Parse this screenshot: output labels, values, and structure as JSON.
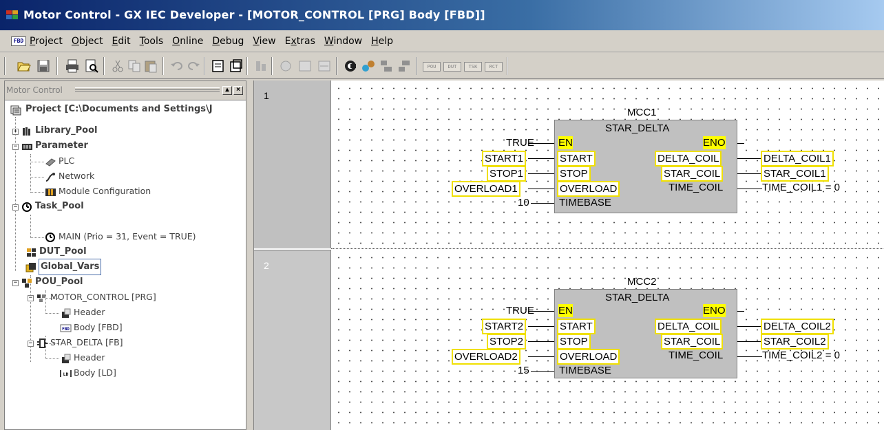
{
  "window": {
    "title": "Motor Control - GX IEC Developer - [MOTOR_CONTROL [PRG] Body [FBD]]",
    "mdi_icon_label": "FBD"
  },
  "menu": [
    "Project",
    "Object",
    "Edit",
    "Tools",
    "Online",
    "Debug",
    "View",
    "Extras",
    "Window",
    "Help"
  ],
  "toolbar": {
    "buttons": [
      "open-icon",
      "save-icon",
      "print-icon",
      "print-preview-icon",
      "cut-icon",
      "copy-icon",
      "paste-icon",
      "undo-icon",
      "redo-icon",
      "properties-icon",
      "open-object-icon",
      "check-icon",
      "build-icon",
      "rebuild-icon",
      "rebuild-all-icon",
      "monitor-icon",
      "transfer-icon",
      "download-icon",
      "upload-icon"
    ],
    "labels": [
      "POU",
      "DUT",
      "TSK",
      "RCT"
    ]
  },
  "project_panel": {
    "title": "Motor Control",
    "tree": [
      {
        "label": "Project [C:\\Documents and Settings\\J",
        "bold": true
      },
      {
        "label": "Library_Pool",
        "bold": true
      },
      {
        "label": "Parameter",
        "bold": true
      },
      {
        "label": "PLC",
        "bold": false
      },
      {
        "label": "Network",
        "bold": false
      },
      {
        "label": "Module Configuration",
        "bold": false
      },
      {
        "label": "Task_Pool",
        "bold": true
      },
      {
        "label": "MAIN (Prio = 31, Event = TRUE)",
        "bold": false
      },
      {
        "label": "DUT_Pool",
        "bold": true
      },
      {
        "label": "Global_Vars",
        "bold": true
      },
      {
        "label": "POU_Pool",
        "bold": true
      },
      {
        "label": "MOTOR_CONTROL [PRG]",
        "bold": false
      },
      {
        "label": "Header",
        "bold": false
      },
      {
        "label": "Body [FBD]",
        "bold": false
      },
      {
        "label": "STAR_DELTA [FB]",
        "bold": false
      },
      {
        "label": "Header",
        "bold": false
      },
      {
        "label": "Body [LD]",
        "bold": false
      }
    ]
  },
  "networks": [
    {
      "number": "1",
      "instance": "MCC1",
      "fb_type": "STAR_DELTA",
      "inputs": [
        "TRUE",
        "START1",
        "STOP1",
        "OVERLOAD1",
        "10"
      ],
      "pins_in": [
        "EN",
        "START",
        "STOP",
        "OVERLOAD",
        "TIMEBASE"
      ],
      "pins_out": [
        "ENO",
        "DELTA_COIL",
        "STAR_COIL",
        "TIME_COIL"
      ],
      "outputs": [
        "DELTA_COIL1",
        "STAR_COIL1",
        "TIME_COIL1 = 0"
      ]
    },
    {
      "number": "2",
      "instance": "MCC2",
      "fb_type": "STAR_DELTA",
      "inputs": [
        "TRUE",
        "START2",
        "STOP2",
        "OVERLOAD2",
        "15"
      ],
      "pins_in": [
        "EN",
        "START",
        "STOP",
        "OVERLOAD",
        "TIMEBASE"
      ],
      "pins_out": [
        "ENO",
        "DELTA_COIL",
        "STAR_COIL",
        "TIME_COIL"
      ],
      "outputs": [
        "DELTA_COIL2",
        "STAR_COIL2",
        "TIME_COIL2 = 0"
      ]
    }
  ]
}
